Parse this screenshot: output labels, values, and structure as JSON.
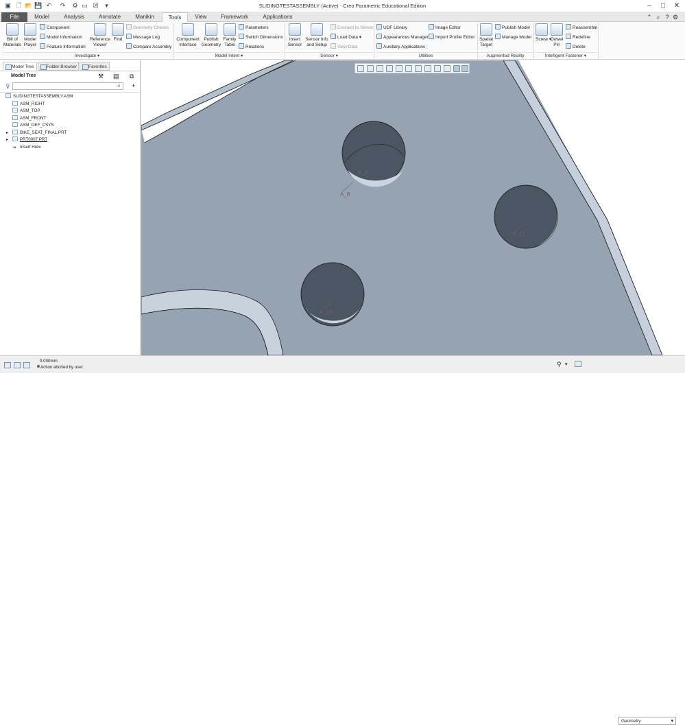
{
  "window": {
    "title": "SLIDINGTESTASSEMBLY (Active) - Creo Parametric Educational Edition"
  },
  "tabs": [
    "File",
    "Model",
    "Analysis",
    "Annotate",
    "Manikin",
    "Tools",
    "View",
    "Framework",
    "Applications"
  ],
  "active_tab": "Tools",
  "ribbon": {
    "investigate": {
      "label": "Investigate",
      "bill_of_materials": "Bill of\nMaterials",
      "model_player": "Model\nPlayer",
      "component": "Component",
      "model_information": "Model Information",
      "feature_information": "Feature Information",
      "reference_viewer": "Reference\nViewer",
      "find": "Find",
      "geometry_checks": "Geometry Checks",
      "message_log": "Message Log",
      "compare_assembly": "Compare Assembly"
    },
    "model_intent": {
      "label": "Model Intent",
      "component_interface": "Component\nInterface",
      "publish_geometry": "Publish\nGeometry",
      "family_table": "Family\nTable",
      "parameters": "Parameters",
      "switch_dimensions": "Switch Dimensions",
      "relations": "Relations"
    },
    "sensor": {
      "label": "Sensor",
      "insert_sensor": "Insert\nSensor",
      "sensor_info": "Sensor Info\nand Setup",
      "connect_to_server": "Connect to Server",
      "load_data": "Load Data",
      "view_data": "View Data"
    },
    "utilities": {
      "label": "Utilities",
      "udf_library": "UDF Library",
      "appearances_manager": "Appearances Manager",
      "auxiliary_applications": "Auxiliary Applications",
      "image_editor": "Image Editor",
      "import_profile_editor": "Import Profile Editor"
    },
    "augmented_reality": {
      "label": "Augmented Reality",
      "spatial_target": "Spatial\nTarget",
      "publish_model": "Publish Model",
      "manage_model": "Manage Model"
    },
    "intelligent_fastener": {
      "label": "Intelligent Fastener",
      "screw": "Screw",
      "dowel_pin": "Dowel\nPin",
      "reassemble": "Reassemble",
      "redefine": "Redefine",
      "delete": "Delete"
    }
  },
  "panel": {
    "tabs": [
      "Model Tree",
      "Folder Browser",
      "Favorites"
    ],
    "header": "Model Tree",
    "tree": [
      {
        "label": "SLIDINGTESTASSEMBLY.ASM",
        "level": 0
      },
      {
        "label": "ASM_RIGHT",
        "level": 1
      },
      {
        "label": "ASM_TOP",
        "level": 1
      },
      {
        "label": "ASM_FRONT",
        "level": 1
      },
      {
        "label": "ASM_DEF_CSYS",
        "level": 1
      },
      {
        "label": "BIKE_SEAT_FINAL.PRT",
        "level": 1
      },
      {
        "label": "PRT0007.PRT",
        "level": 1
      },
      {
        "label": "Insert Here",
        "level": 1
      }
    ]
  },
  "viewport": {
    "hole_labels": [
      "A_8",
      "A_4",
      "A_17",
      "A_19"
    ]
  },
  "status": {
    "value": "0.000mm",
    "message": "Action aborted by user.",
    "filter": "Geometry"
  }
}
